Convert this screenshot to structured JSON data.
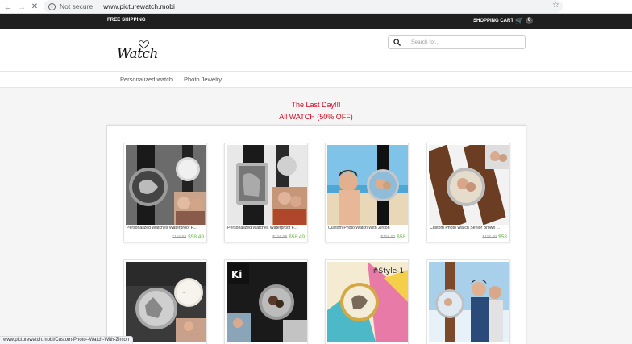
{
  "browser": {
    "security_label": "Not secure",
    "url": "www.picturewatch.mobi",
    "icons": [
      "back-arrow-icon",
      "forward-arrow-icon",
      "close-icon",
      "info-icon",
      "star-icon"
    ]
  },
  "topbar": {
    "free_shipping": "FREE SHIPPING",
    "cart_label": "SHOPPING CART",
    "cart_count": "0"
  },
  "header": {
    "logo_text": "Watch",
    "search_placeholder": "Search for..."
  },
  "nav": {
    "items": [
      {
        "label": "Personalized watch"
      },
      {
        "label": "Photo Jewelry"
      }
    ]
  },
  "promo": {
    "line1": "The Last Day!!!",
    "line2": "All WATCH (50% OFF)"
  },
  "products": [
    {
      "title": "Personalized Watches Waterproof F...",
      "old_price": "$116.98",
      "price": "$58.49"
    },
    {
      "title": "Personalized Watches Waterproof F...",
      "old_price": "$116.98",
      "price": "$58.49"
    },
    {
      "title": "Custom Photo Watch With Zircon",
      "old_price": "$116.00",
      "price": "$58"
    },
    {
      "title": "Custom Photo Watch Senior Brown ...",
      "old_price": "$116.00",
      "price": "$58"
    },
    {
      "title": "",
      "old_price": "",
      "price": ""
    },
    {
      "title": "",
      "old_price": "",
      "price": ""
    },
    {
      "title": "",
      "old_price": "",
      "price": ""
    },
    {
      "title": "",
      "old_price": "",
      "price": ""
    }
  ],
  "status_bar": {
    "url": "www.picturewatch.mobi/Custom-Photo--Watch-With-Zircon"
  },
  "colors": {
    "topbar_bg": "#1f1f1f",
    "promo_red": "#d0021b",
    "price_green": "#6ab344",
    "page_bg": "#f5f5f5"
  }
}
